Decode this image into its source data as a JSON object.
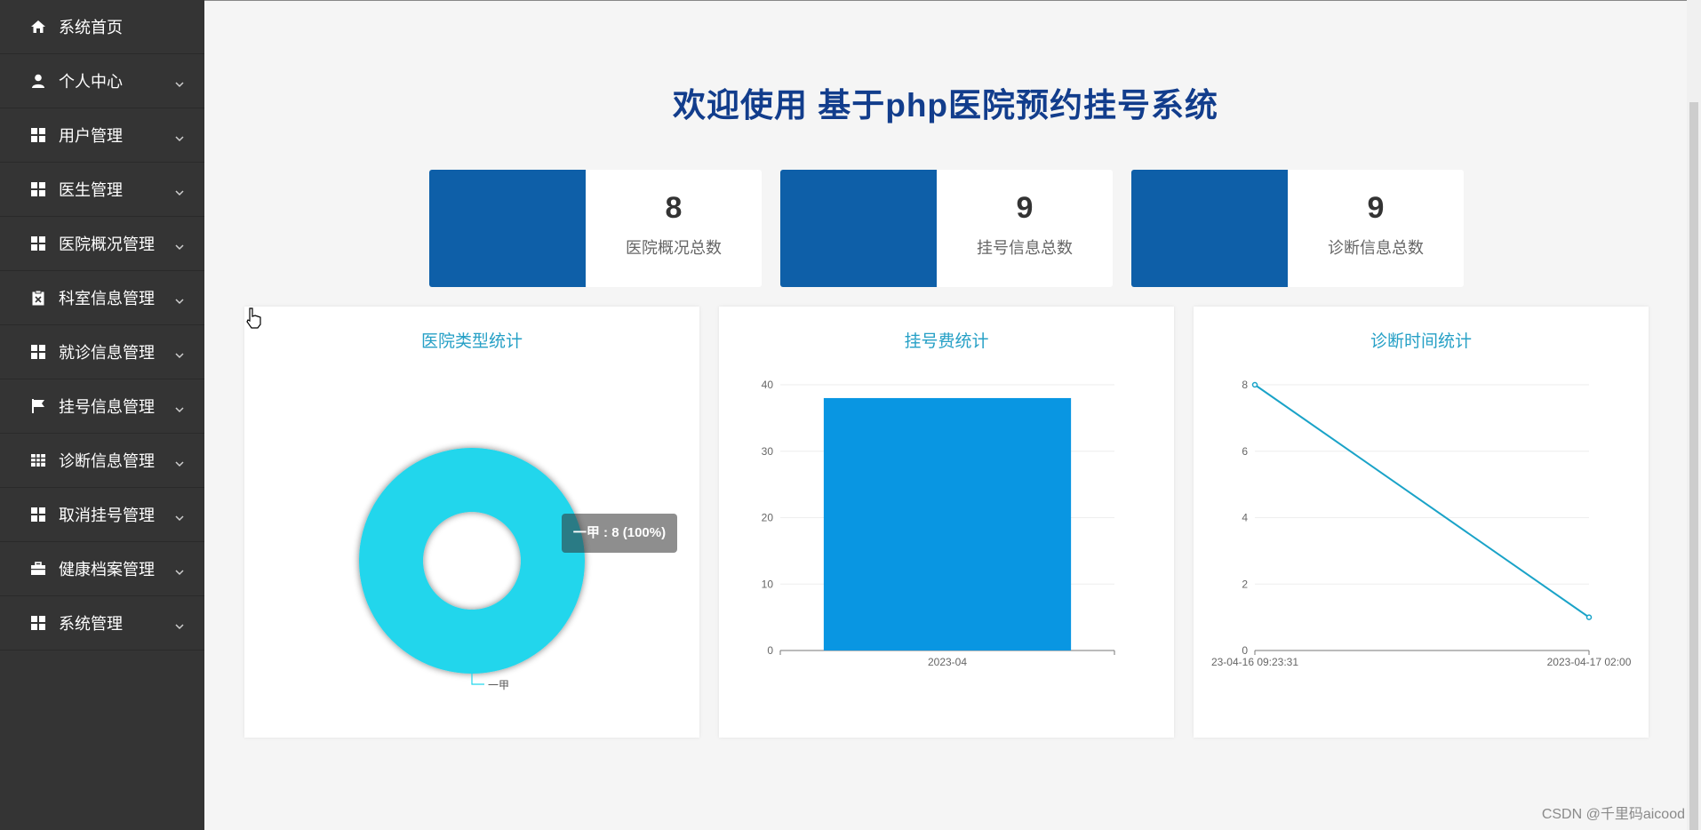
{
  "sidebar": {
    "items": [
      {
        "label": "系统首页",
        "icon": "home-icon",
        "has_chevron": false
      },
      {
        "label": "个人中心",
        "icon": "user-icon",
        "has_chevron": true
      },
      {
        "label": "用户管理",
        "icon": "grid-icon",
        "has_chevron": true
      },
      {
        "label": "医生管理",
        "icon": "grid-icon",
        "has_chevron": true
      },
      {
        "label": "医院概况管理",
        "icon": "grid-icon",
        "has_chevron": true
      },
      {
        "label": "科室信息管理",
        "icon": "clipboard-icon",
        "has_chevron": true
      },
      {
        "label": "就诊信息管理",
        "icon": "grid-icon",
        "has_chevron": true
      },
      {
        "label": "挂号信息管理",
        "icon": "flag-icon",
        "has_chevron": true
      },
      {
        "label": "诊断信息管理",
        "icon": "table-icon",
        "has_chevron": true
      },
      {
        "label": "取消挂号管理",
        "icon": "grid-icon",
        "has_chevron": true
      },
      {
        "label": "健康档案管理",
        "icon": "briefcase-icon",
        "has_chevron": true
      },
      {
        "label": "系统管理",
        "icon": "grid-icon",
        "has_chevron": true
      }
    ]
  },
  "header": {
    "title": "欢迎使用 基于php医院预约挂号系统"
  },
  "stats": [
    {
      "value": "8",
      "label": "医院概况总数"
    },
    {
      "value": "9",
      "label": "挂号信息总数"
    },
    {
      "value": "9",
      "label": "诊断信息总数"
    }
  ],
  "colors": {
    "sidebar_bg": "#343434",
    "title": "#123d8c",
    "stat_block": "#0e5fa8",
    "chart_title": "#26a0c6",
    "donut": "#22d6ec",
    "bar": "#0996e2",
    "line": "#1aa3c8"
  },
  "chart_data": [
    {
      "type": "pie",
      "title": "医院类型统计",
      "categories": [
        "一甲"
      ],
      "values": [
        8
      ],
      "legend": [
        "一甲"
      ],
      "tooltip": "一甲 : 8 (100%)"
    },
    {
      "type": "bar",
      "title": "挂号费统计",
      "categories": [
        "2023-04"
      ],
      "values": [
        38
      ],
      "ylim": [
        0,
        40
      ],
      "yticks": [
        "0",
        "10",
        "20",
        "30",
        "40"
      ]
    },
    {
      "type": "line",
      "title": "诊断时间统计",
      "categories": [
        "2023-04-16 09:23:31",
        "2023-04-17 02:00"
      ],
      "x_tick_labels": [
        "23-04-16 09:23:31",
        "2023-04-17 02:00"
      ],
      "values": [
        8,
        1
      ],
      "ylim": [
        0,
        8
      ],
      "yticks": [
        "0",
        "2",
        "4",
        "6",
        "8"
      ]
    }
  ],
  "watermark": "CSDN @千里码aicood"
}
